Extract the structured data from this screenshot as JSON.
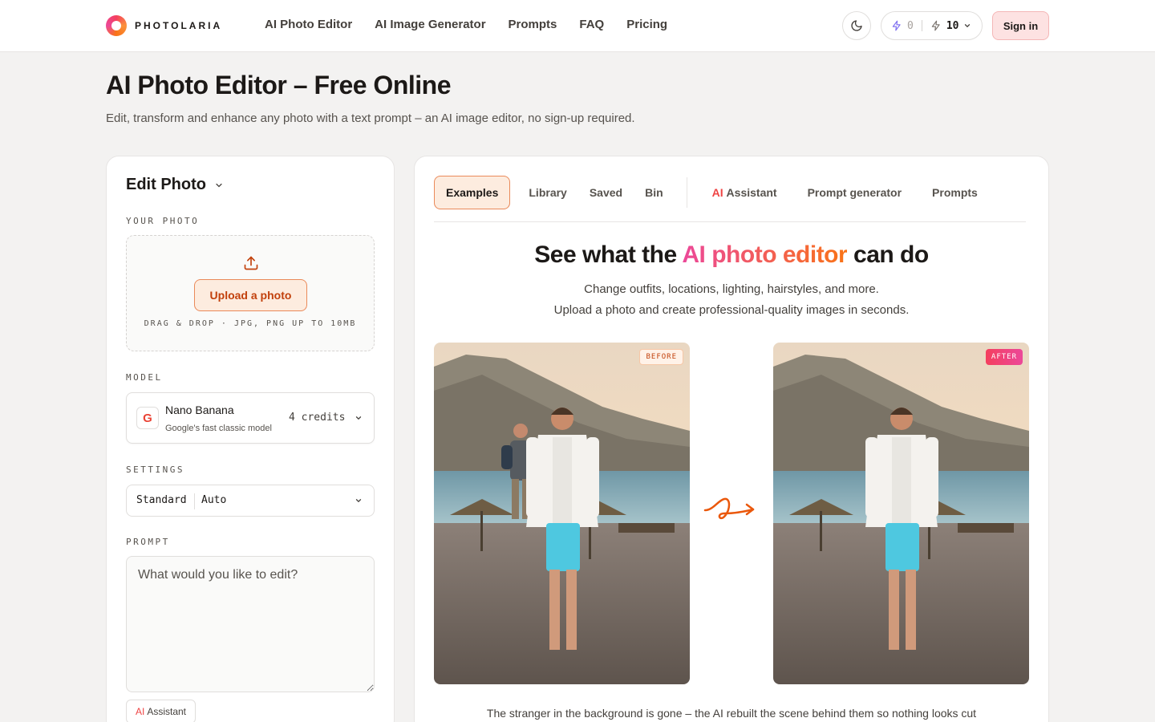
{
  "header": {
    "logo_text": "PHOTOLARIA",
    "nav": [
      "AI Photo Editor",
      "AI Image Generator",
      "Prompts",
      "FAQ",
      "Pricing"
    ],
    "credits_used": "0",
    "credits_total": "10",
    "sign_in": "Sign in"
  },
  "page": {
    "title": "AI Photo Editor – Free Online",
    "subtitle": "Edit, transform and enhance any photo with a text prompt – an AI image editor, no sign-up required."
  },
  "editor": {
    "title": "Edit Photo",
    "your_photo_label": "YOUR PHOTO",
    "upload_button": "Upload a photo",
    "drop_hint": "DRAG & DROP · JPG, PNG UP TO 10MB",
    "model_label": "MODEL",
    "model_name": "Nano Banana",
    "model_desc": "Google's fast classic model",
    "model_credits": "4 credits",
    "model_logo": "G",
    "settings_label": "SETTINGS",
    "settings_quality": "Standard",
    "settings_ratio": "Auto",
    "prompt_label": "PROMPT",
    "prompt_placeholder": "What would you like to edit?",
    "assistant_ai": "AI",
    "assistant_label": "Assistant"
  },
  "tabs": {
    "examples": "Examples",
    "library": "Library",
    "saved": "Saved",
    "bin": "Bin",
    "assistant_ai": "AI",
    "assistant": "Assistant",
    "prompt_generator": "Prompt generator",
    "prompts": "Prompts"
  },
  "showcase": {
    "title_pre": "See what the ",
    "title_highlight": "AI photo editor",
    "title_post": " can do",
    "sub_line1": "Change outfits, locations, lighting, hairstyles, and more.",
    "sub_line2": "Upload a photo and create professional-quality images in seconds.",
    "before_tag": "BEFORE",
    "after_tag": "AFTER",
    "caption": "The stranger in the background is gone – the AI rebuilt the scene behind them so nothing looks cut"
  },
  "colors": {
    "accent": "#f97316",
    "accent_pink": "#ec4899",
    "signin_bg": "#fde2e2"
  }
}
